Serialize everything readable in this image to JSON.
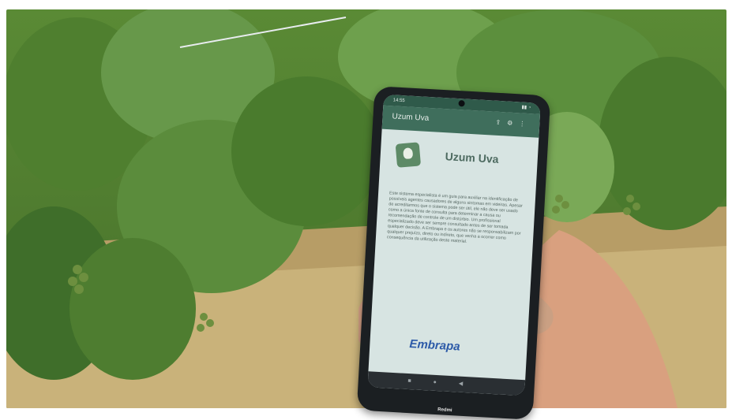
{
  "photo": {
    "subject": "hand holding smartphone in front of grape vines",
    "colors": {
      "leaf_dark": "#3f6e2a",
      "leaf_mid": "#5f8f3d",
      "leaf_light": "#8db55f",
      "straw": "#c9b27a",
      "skin": "#d9a07f",
      "phone_body": "#1b1f22"
    }
  },
  "phone": {
    "status_time": "14:55",
    "app_bar_title": "Uzum Uva",
    "app_bar_icons": [
      "share-icon",
      "settings-icon",
      "more-icon"
    ],
    "app_name": "Uzum Uva",
    "description": "Este sistema especialista é um guia para auxiliar na identificação de possíveis agentes causadores de alguns sintomas em videiras. Apesar de acreditarmos que o sistema pode ser útil, ele não deve ser usado como a única fonte de consulta para determinar a causa ou recomendação de controle de um distúrbio. Um profissional especializado deve ser sempre consultado antes de ser tomada qualquer decisão. A Embrapa e os autores não se responsabilizam por qualquer prejuízo, direto ou indireto, que venha a ocorrer como consequência da utilização deste material.",
    "footer_logo": "Embrapa",
    "nav_icons": [
      "square-icon",
      "home-circle-icon",
      "back-triangle-icon"
    ],
    "brand_label": "Redmi"
  }
}
